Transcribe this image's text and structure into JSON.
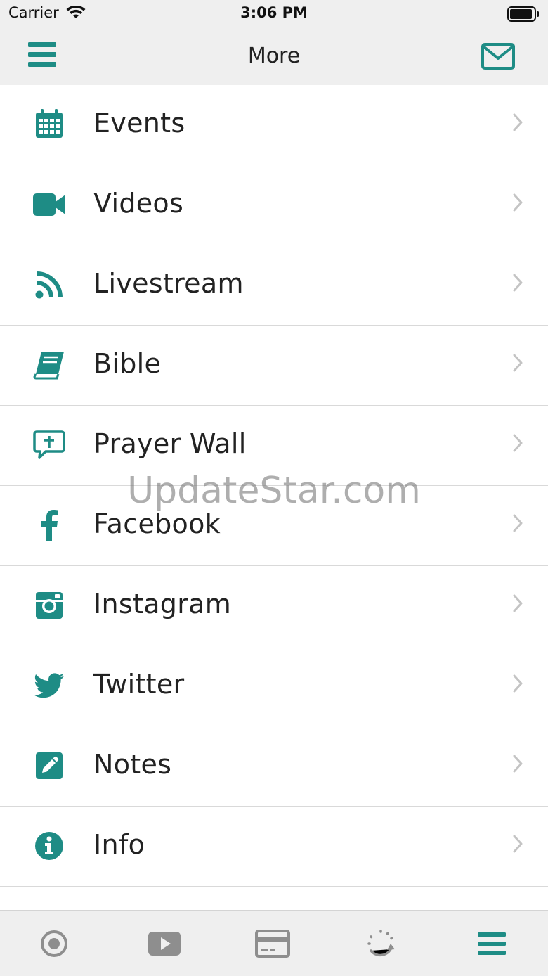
{
  "status_bar": {
    "carrier": "Carrier",
    "time": "3:06 PM"
  },
  "nav": {
    "title": "More"
  },
  "colors": {
    "accent": "#1e8c85",
    "inactive": "#8e8e8e",
    "bar_bg": "#efefef"
  },
  "menu_items": [
    {
      "label": "Events",
      "icon": "calendar-icon"
    },
    {
      "label": "Videos",
      "icon": "video-camera-icon"
    },
    {
      "label": "Livestream",
      "icon": "rss-icon"
    },
    {
      "label": "Bible",
      "icon": "book-icon"
    },
    {
      "label": "Prayer Wall",
      "icon": "prayer-bubble-icon"
    },
    {
      "label": "Facebook",
      "icon": "facebook-icon"
    },
    {
      "label": "Instagram",
      "icon": "instagram-icon"
    },
    {
      "label": "Twitter",
      "icon": "twitter-icon"
    },
    {
      "label": "Notes",
      "icon": "pencil-square-icon"
    },
    {
      "label": "Info",
      "icon": "info-circle-icon"
    }
  ],
  "watermark": "UpdateStar.com",
  "tabs": [
    {
      "icon": "record-icon"
    },
    {
      "icon": "play-icon"
    },
    {
      "icon": "credit-card-icon"
    },
    {
      "icon": "spinner-icon"
    },
    {
      "icon": "menu-icon"
    }
  ]
}
